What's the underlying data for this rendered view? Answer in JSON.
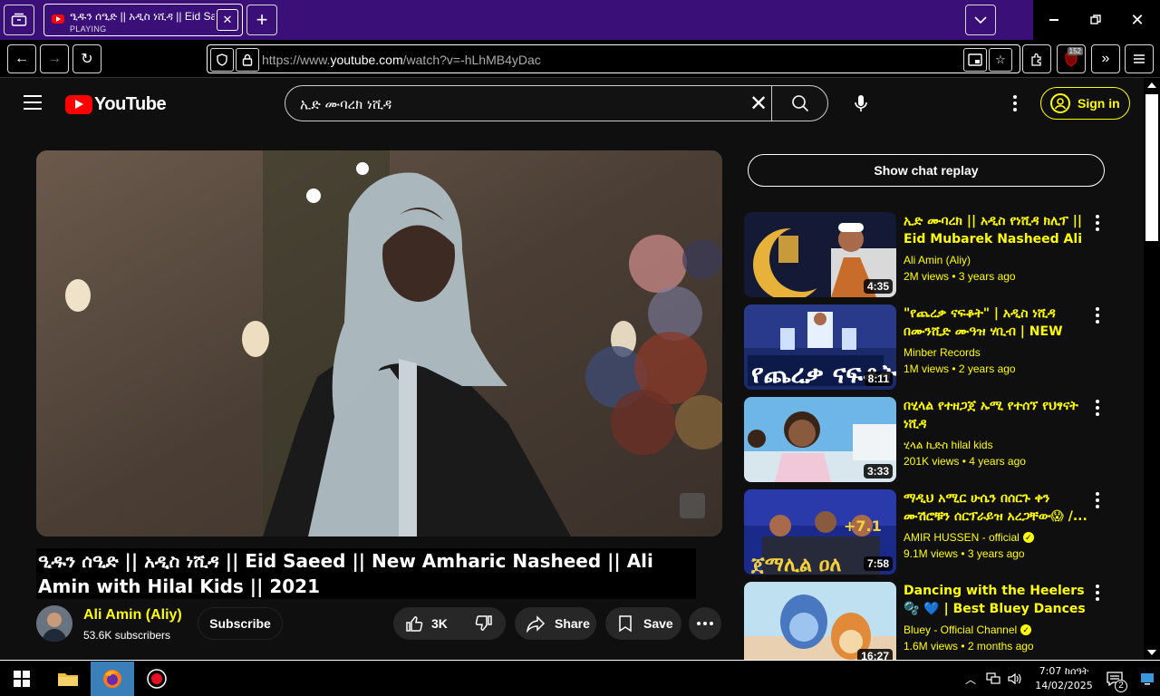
{
  "browser": {
    "tab": {
      "title": "ዒዱን ሰዒድ || አዲስ ነሺዳ || Eid Saeed || New Amharic Nasheed",
      "status": "PLAYING"
    },
    "url": {
      "prefix": "https://www.",
      "host": "youtube.com",
      "path": "/watch?v=-hLhMB4yDac"
    },
    "ublock_count": "152"
  },
  "youtube": {
    "logo_text": "YouTube",
    "search_query": "ኢድ ሙባረክ ነሺዳ",
    "sign_in": "Sign in",
    "video": {
      "title": "ዒዱን ሰዒድ || አዲስ ነሺዳ || Eid Saeed || New Amharic Nasheed || Ali Amin with Hilal Kids || 2021",
      "channel": "Ali Amin (Aliy)",
      "subscribers": "53.6K subscribers",
      "subscribe_label": "Subscribe",
      "likes": "3K",
      "share_label": "Share",
      "save_label": "Save"
    },
    "chat_replay": "Show chat replay",
    "recommendations": [
      {
        "title": "ኢድ ሙባረክ || አዲስ የነሺዳ ክሊፕ || Eid Mubarek Nasheed Ali Amin",
        "channel": "Ali Amin (Aliy)",
        "verified": false,
        "meta": "2M views • 3 years ago",
        "duration": "4:35"
      },
      {
        "title": "\"የጨረቃ ናፍቆት\" | አዲስ ነሺዳ በሙንሺድ ሙዓዝ ሃቢብ | NEW AMHARIC NASHEED",
        "channel": "Minber Records",
        "verified": false,
        "meta": "1M views • 2 years ago",
        "duration": "8:11"
      },
      {
        "title": "በሂላል የተዘጋጀ ኡሚ የተሰኘ የህፃናት ነሺዳ",
        "channel": "ሂላል ኪድስ hilal kids",
        "verified": false,
        "meta": "201K views • 4 years ago",
        "duration": "3:33"
      },
      {
        "title": "ማዲህ አሚር ሁሴን በሰርጉ ቀን ሙሽሮቹን ሰርፕራይዝ አረጋቸው😱 /...",
        "channel": "AMIR HUSSEN - official",
        "verified": true,
        "meta": "9.1M views • 3 years ago",
        "duration": "7:58"
      },
      {
        "title": "Dancing with the Heelers 🫧 💙 | Best Bluey Dances and More!...",
        "channel": "Bluey - Official Channel",
        "verified": true,
        "meta": "1.6M views • 2 months ago",
        "duration": "16:27"
      }
    ]
  },
  "taskbar": {
    "time": "7:07 ከሰዓት",
    "date": "14/02/2025",
    "notifications": "2"
  },
  "colors": {
    "accent": "#ffff00",
    "tabbar": "#3b0f78"
  }
}
